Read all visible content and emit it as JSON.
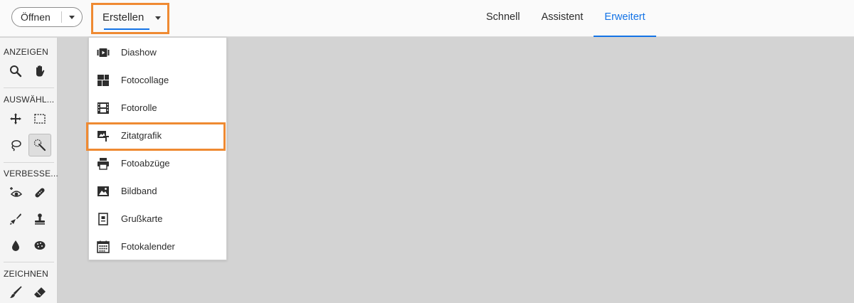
{
  "topbar": {
    "open_label": "Öffnen",
    "create_label": "Erstellen",
    "modes": [
      "Schnell",
      "Assistent",
      "Erweitert"
    ],
    "active_mode": "Erweitert"
  },
  "toolbar": {
    "sections": [
      {
        "label": "ANZEIGEN",
        "tools": [
          "zoom-tool-icon",
          "hand-tool-icon"
        ]
      },
      {
        "label": "AUSWÄHL...",
        "tools": [
          "move-tool-icon",
          "rectangular-marquee-icon",
          "lasso-tool-icon",
          "quick-selection-icon"
        ]
      },
      {
        "label": "VERBESSE...",
        "tools": [
          "red-eye-icon",
          "healing-brush-icon",
          "smart-brush-icon",
          "clone-stamp-icon",
          "blur-tool-icon",
          "sponge-tool-icon"
        ]
      },
      {
        "label": "ZEICHNEN",
        "tools": [
          "brush-tool-icon",
          "eraser-tool-icon"
        ]
      }
    ],
    "selected_tool": "quick-selection-icon"
  },
  "menu": {
    "items": [
      {
        "label": "Diashow",
        "icon": "slideshow-icon"
      },
      {
        "label": "Fotocollage",
        "icon": "collage-icon"
      },
      {
        "label": "Fotorolle",
        "icon": "filmstrip-icon"
      },
      {
        "label": "Zitatgrafik",
        "icon": "quote-graphic-icon"
      },
      {
        "label": "Fotoabzüge",
        "icon": "printer-icon"
      },
      {
        "label": "Bildband",
        "icon": "photo-book-icon"
      },
      {
        "label": "Grußkarte",
        "icon": "greeting-card-icon"
      },
      {
        "label": "Fotokalender",
        "icon": "calendar-icon"
      }
    ],
    "highlighted": "Zitatgrafik"
  },
  "colors": {
    "accent": "#1473e6",
    "highlight_outline": "#ef8a32",
    "canvas": "#d3d3d3"
  }
}
